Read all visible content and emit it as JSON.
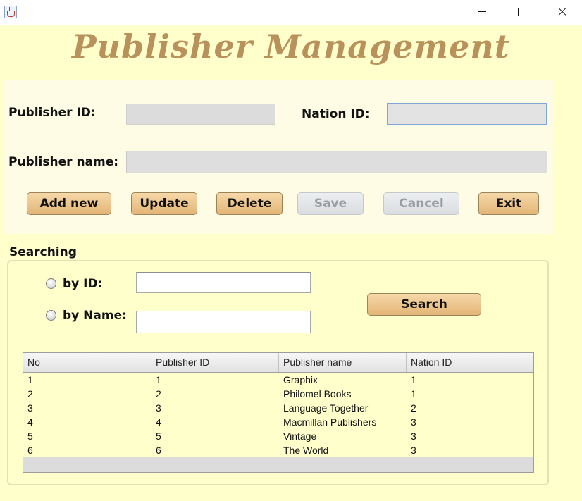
{
  "app": {
    "title": "Publisher Management"
  },
  "form": {
    "publisher_id_label": "Publisher ID:",
    "publisher_id_value": "",
    "nation_id_label": "Nation ID:",
    "nation_id_value": "",
    "publisher_name_label": "Publisher name:",
    "publisher_name_value": ""
  },
  "buttons": {
    "add_new": "Add new",
    "update": "Update",
    "delete": "Delete",
    "save": "Save",
    "cancel": "Cancel",
    "exit": "Exit"
  },
  "search": {
    "heading": "Searching",
    "by_id_label": "by ID:",
    "by_name_label": "by Name:",
    "by_id_value": "",
    "by_name_value": "",
    "button": "Search"
  },
  "table": {
    "columns": [
      "No",
      "Publisher ID",
      "Publisher name",
      "Nation ID"
    ],
    "rows": [
      [
        "1",
        "1",
        "Graphix",
        "1"
      ],
      [
        "2",
        "2",
        "Philomel Books",
        "1"
      ],
      [
        "3",
        "3",
        "Language Together",
        "2"
      ],
      [
        "4",
        "4",
        "Macmillan Publishers",
        "3"
      ],
      [
        "5",
        "5",
        "Vintage",
        "3"
      ],
      [
        "6",
        "6",
        "The World",
        "3"
      ]
    ]
  },
  "colors": {
    "background": "#ffffcc",
    "title": "#b8925a",
    "button": "#e8bd82"
  },
  "icons": [
    "java-app-icon",
    "minimize-icon",
    "maximize-icon",
    "close-icon"
  ]
}
